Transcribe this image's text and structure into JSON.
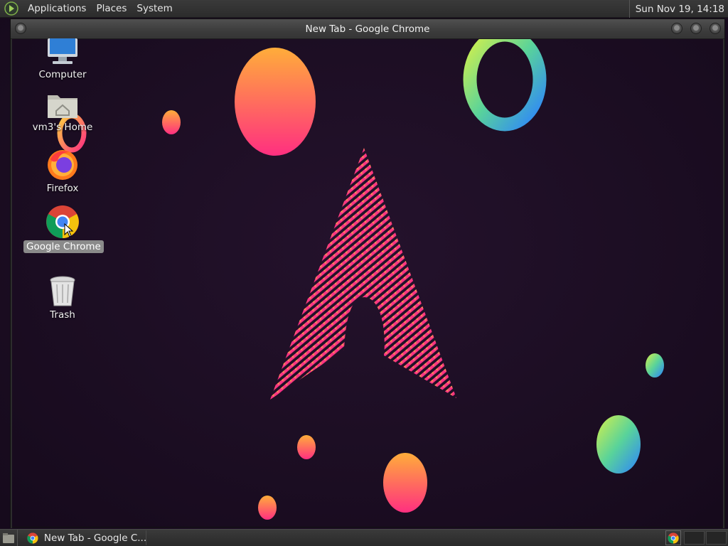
{
  "top_panel": {
    "menus": [
      "Applications",
      "Places",
      "System"
    ],
    "clock": "Sun Nov 19, 14:18"
  },
  "window": {
    "title": "New Tab - Google Chrome"
  },
  "desktop_icons": {
    "computer": "Computer",
    "home": "vm3's Home",
    "firefox": "Firefox",
    "chrome": "Google Chrome",
    "trash": "Trash"
  },
  "taskbar": {
    "task_label": "New Tab - Google C..."
  },
  "colors": {
    "wallpaper_bg": "#1c0f24",
    "accent_pink": "#ff2e8a",
    "accent_orange": "#ffa040"
  }
}
